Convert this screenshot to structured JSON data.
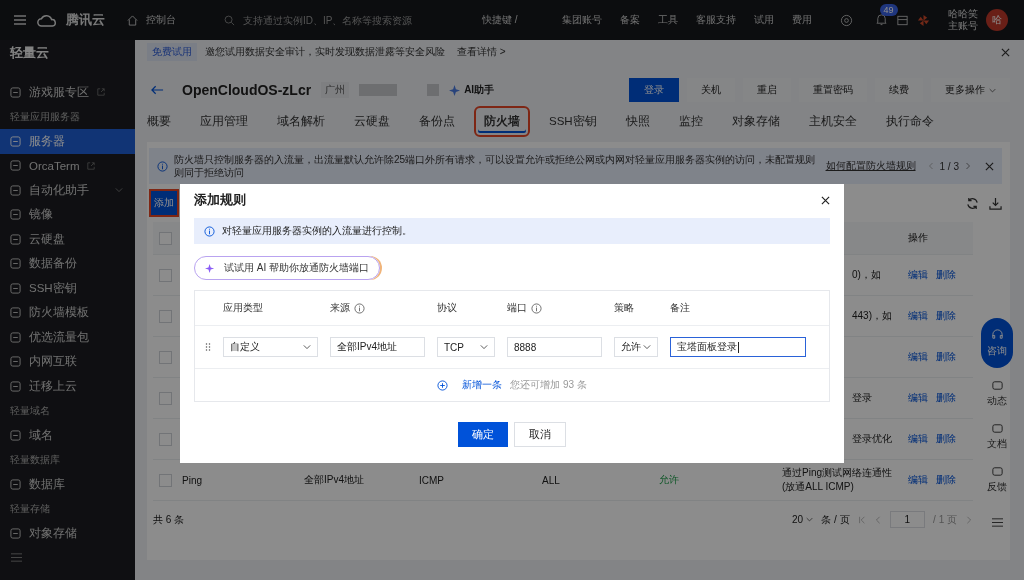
{
  "topbar": {
    "brand": "腾讯云",
    "console": "控制台",
    "search_placeholder": "支持通过实例ID、IP、名称等搜索资源",
    "shortcut": "快捷键 /",
    "links": [
      "集团账号",
      "备案",
      "工具",
      "客服支持",
      "试用",
      "费用"
    ],
    "notification_count": "49",
    "user_name": "哈哈笑",
    "user_role": "主账号",
    "avatar": "哈"
  },
  "sidebar": {
    "title": "轻量云",
    "items": [
      {
        "kind": "item",
        "label": "游戏服专区",
        "selected": false,
        "external": true
      },
      {
        "kind": "section",
        "label": "轻量应用服务器"
      },
      {
        "kind": "item",
        "label": "服务器",
        "selected": true,
        "external": false
      },
      {
        "kind": "item",
        "label": "OrcaTerm",
        "selected": false,
        "external": true
      },
      {
        "kind": "group",
        "label": "自动化助手",
        "selected": false,
        "expanded": false
      },
      {
        "kind": "item",
        "label": "镜像",
        "selected": false,
        "external": false
      },
      {
        "kind": "item",
        "label": "云硬盘",
        "selected": false,
        "external": false
      },
      {
        "kind": "item",
        "label": "数据备份",
        "selected": false,
        "external": false
      },
      {
        "kind": "item",
        "label": "SSH密钥",
        "selected": false,
        "external": false
      },
      {
        "kind": "item",
        "label": "防火墙模板",
        "selected": false,
        "external": false
      },
      {
        "kind": "item",
        "label": "优选流量包",
        "selected": false,
        "external": false
      },
      {
        "kind": "item",
        "label": "内网互联",
        "selected": false,
        "external": false
      },
      {
        "kind": "item",
        "label": "迁移上云",
        "selected": false,
        "external": false
      },
      {
        "kind": "section",
        "label": "轻量域名"
      },
      {
        "kind": "item",
        "label": "域名",
        "selected": false,
        "external": false
      },
      {
        "kind": "section",
        "label": "轻量数据库"
      },
      {
        "kind": "item",
        "label": "数据库",
        "selected": false,
        "external": false
      },
      {
        "kind": "section",
        "label": "轻量存储"
      },
      {
        "kind": "item",
        "label": "对象存储",
        "selected": false,
        "external": false
      }
    ]
  },
  "promo": {
    "tag": "免费试用",
    "text": "邀您试用数据安全审计，实时发现数据泄露等安全风险",
    "link": "查看详情 >"
  },
  "instance": {
    "name": "OpenCloudOS-zLcr",
    "region": "广州",
    "ai": "AI助手",
    "buttons": [
      {
        "label": "登录",
        "primary": true
      },
      {
        "label": "关机",
        "primary": false
      },
      {
        "label": "重启",
        "primary": false
      },
      {
        "label": "重置密码",
        "primary": false
      },
      {
        "label": "续费",
        "primary": false
      },
      {
        "label": "更多操作",
        "primary": false
      }
    ]
  },
  "tabs": [
    {
      "label": "概要",
      "selected": false,
      "highlighted": false
    },
    {
      "label": "应用管理",
      "selected": false,
      "highlighted": false
    },
    {
      "label": "域名解析",
      "selected": false,
      "highlighted": false
    },
    {
      "label": "云硬盘",
      "selected": false,
      "highlighted": false
    },
    {
      "label": "备份点",
      "selected": false,
      "highlighted": false
    },
    {
      "label": "防火墙",
      "selected": true,
      "highlighted": true
    },
    {
      "label": "SSH密钥",
      "selected": false,
      "highlighted": false
    },
    {
      "label": "快照",
      "selected": false,
      "highlighted": false
    },
    {
      "label": "监控",
      "selected": false,
      "highlighted": false
    },
    {
      "label": "对象存储",
      "selected": false,
      "highlighted": false
    },
    {
      "label": "主机安全",
      "selected": false,
      "highlighted": false
    },
    {
      "label": "执行命令",
      "selected": false,
      "highlighted": false
    }
  ],
  "tip": {
    "text": "防火墙只控制服务器的入流量，出流量默认允许除25端口外所有请求，可以设置允许或拒绝公网或内网对轻量应用服务器实例的访问，未配置规则则同于拒绝访问",
    "link": "如何配置防火墙规则",
    "pager": "1 / 3"
  },
  "toolbar": {
    "add_label": "添加",
    "add_highlighted": true
  },
  "table": {
    "header_checked": false,
    "ops_header": "操作",
    "rows": [
      {
        "checked": false,
        "remark": "0)，如",
        "actions": [
          "编辑",
          "删除"
        ]
      },
      {
        "checked": false,
        "remark": "443)，如",
        "actions": [
          "编辑",
          "删除"
        ]
      },
      {
        "checked": false,
        "actions": [
          "编辑",
          "删除"
        ]
      },
      {
        "checked": false,
        "remark": "登录",
        "actions": [
          "编辑",
          "删除"
        ]
      },
      {
        "checked": false,
        "remark": "登录优化",
        "actions": [
          "编辑",
          "删除"
        ]
      },
      {
        "checked": false,
        "type": "Ping",
        "source": "全部IPv4地址",
        "protocol": "ICMP",
        "port": "ALL",
        "policy": "允许",
        "remark": "通过Ping测试网络连通性 (放通ALL ICMP)",
        "actions": [
          "编辑",
          "删除"
        ]
      }
    ],
    "total": "共 6 条",
    "page_size": "20",
    "page_size_unit": "条 / 页",
    "page": "1",
    "page_total": "/ 1 页"
  },
  "float_tools": {
    "consult": "咨询",
    "items": [
      "动态",
      "文档",
      "反馈"
    ]
  },
  "dialog": {
    "title": "添加规则",
    "info": "对轻量应用服务器实例的入流量进行控制。",
    "ai_button": "试试用 AI 帮助你放通防火墙端口",
    "columns": [
      {
        "label": "应用类型",
        "help": false
      },
      {
        "label": "来源",
        "help": true
      },
      {
        "label": "协议",
        "help": false
      },
      {
        "label": "端口",
        "help": true
      },
      {
        "label": "策略",
        "help": false
      },
      {
        "label": "备注",
        "help": false
      }
    ],
    "rule": [
      {
        "kind": "select",
        "value": "自定义",
        "focused": false
      },
      {
        "kind": "input",
        "value": "全部IPv4地址",
        "focused": false
      },
      {
        "kind": "select",
        "value": "TCP",
        "focused": false
      },
      {
        "kind": "input",
        "value": "8888",
        "focused": false
      },
      {
        "kind": "select",
        "value": "允许",
        "focused": false
      },
      {
        "kind": "input",
        "value": "宝塔面板登录",
        "focused": true
      }
    ],
    "add_row": "新增一条",
    "remaining": "您还可增加 93 条",
    "ok": "确定",
    "cancel": "取消"
  }
}
